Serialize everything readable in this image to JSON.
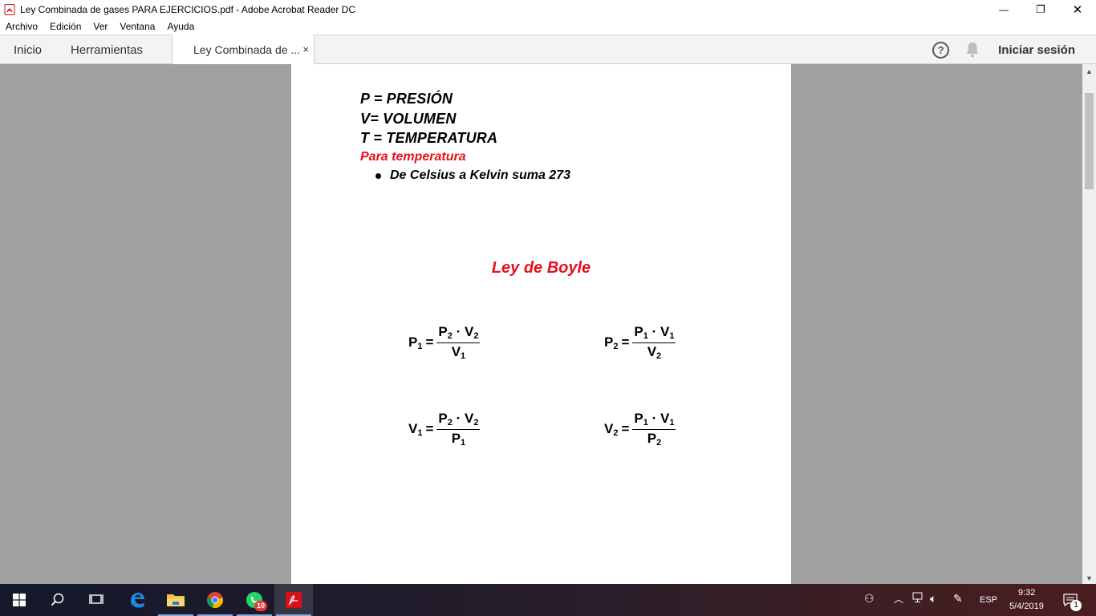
{
  "window": {
    "title": "Ley Combinada de gases PARA EJERCICIOS.pdf - Adobe Acrobat Reader DC",
    "minimize_glyph": "—",
    "maximize_glyph": "❐",
    "close_glyph": "✕"
  },
  "menubar": {
    "items": [
      "Archivo",
      "Edición",
      "Ver",
      "Ventana",
      "Ayuda"
    ]
  },
  "tabs": {
    "home_label": "Inicio",
    "tools_label": "Herramientas",
    "doc_label": "Ley Combinada de ...",
    "close_glyph": "×"
  },
  "toolbar": {
    "help_glyph": "?",
    "signin_label": "Iniciar sesión"
  },
  "document": {
    "definitions": [
      "P = PRESIÓN",
      "V= VOLUMEN",
      "T = TEMPERATURA"
    ],
    "temperature_note": "Para temperatura",
    "bullet": "De Celsius  a Kelvin suma 273",
    "section_title": "Ley de Boyle",
    "formulas": [
      {
        "lhs": "P",
        "lhs_sub": "1",
        "num_a": "P",
        "num_a_sub": "2",
        "num_b": "V",
        "num_b_sub": "2",
        "den": "V",
        "den_sub": "1"
      },
      {
        "lhs": "P",
        "lhs_sub": "2",
        "num_a": "P",
        "num_a_sub": "1",
        "num_b": "V",
        "num_b_sub": "1",
        "den": "V",
        "den_sub": "2"
      },
      {
        "lhs": "V",
        "lhs_sub": "1",
        "num_a": "P",
        "num_a_sub": "2",
        "num_b": "V",
        "num_b_sub": "2",
        "den": "P",
        "den_sub": "1"
      },
      {
        "lhs": "V",
        "lhs_sub": "2",
        "num_a": "P",
        "num_a_sub": "1",
        "num_b": "V",
        "num_b_sub": "1",
        "den": "P",
        "den_sub": "2"
      }
    ],
    "equals": "=",
    "dot": "·"
  },
  "taskbar": {
    "whatsapp_badge": "10",
    "language": "ESP",
    "time": "9:32",
    "date": "5/4/2019",
    "notification_count": "1"
  },
  "colors": {
    "accent_red": "#e8101a",
    "acrobat_red": "#d4101a"
  }
}
